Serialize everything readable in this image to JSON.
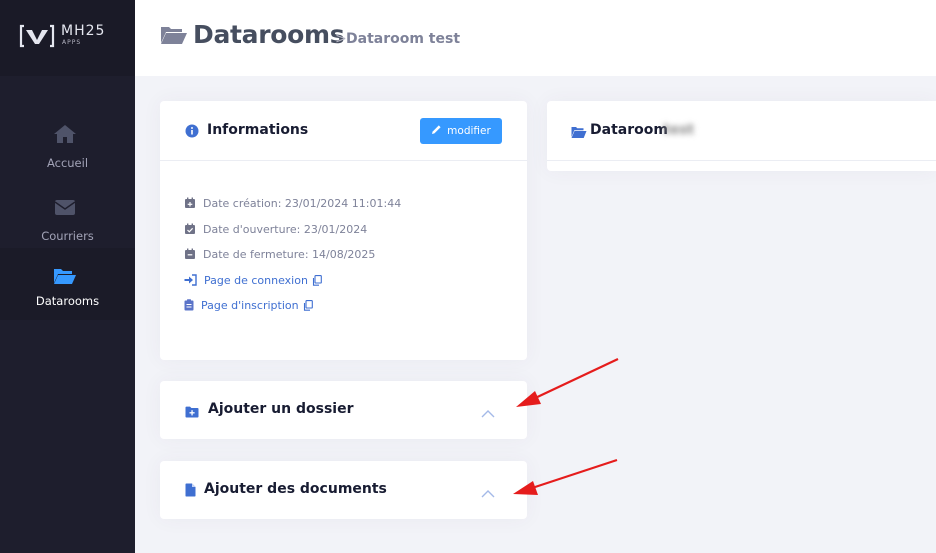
{
  "brand": {
    "name": "MH25",
    "sub": "APPS"
  },
  "sidebar": {
    "items": [
      {
        "label": "Accueil",
        "icon": "home-icon",
        "active": false
      },
      {
        "label": "Courriers",
        "icon": "envelope-icon",
        "active": false
      },
      {
        "label": "Datarooms",
        "icon": "folder-open-icon",
        "active": true
      }
    ]
  },
  "header": {
    "title": "Datarooms",
    "separator": ">",
    "breadcrumb": "Dataroom test"
  },
  "info_card": {
    "title": "Informations",
    "edit_label": "modifier",
    "rows": {
      "creation": "Date création: 23/01/2024 11:01:44",
      "opening": "Date d'ouverture: 23/01/2024",
      "closing": "Date de fermeture: 14/08/2025",
      "login_page": "Page de connexion",
      "signup_page": "Page d'inscription"
    }
  },
  "add_folder_card": {
    "title": "Ajouter un dossier"
  },
  "add_docs_card": {
    "title": "Ajouter des documents"
  },
  "dataroom_card": {
    "title": "Dataroom",
    "title_suffix": "test"
  },
  "colors": {
    "accent": "#3699ff",
    "sidebar_bg": "#1e1e2d",
    "annotation": "#e51c1c"
  }
}
